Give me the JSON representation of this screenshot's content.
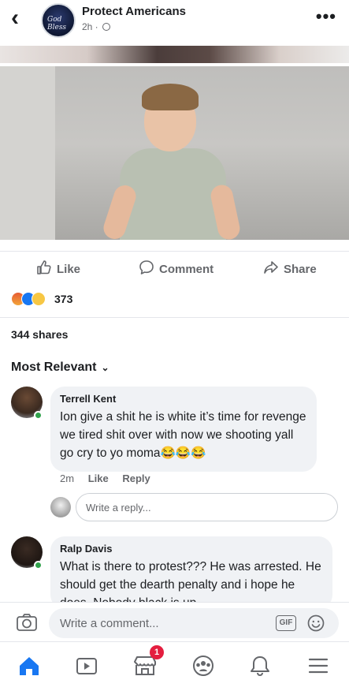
{
  "header": {
    "back_glyph": "‹",
    "page_name": "Protect Americans",
    "page_avatar_text": "God Bless",
    "time": "2h ·",
    "privacy_icon": "globe-icon",
    "more_glyph": "•••"
  },
  "post": {
    "media": "photo-of-smiling-child",
    "actions": {
      "like": "Like",
      "comment": "Comment",
      "share": "Share"
    },
    "reactions": {
      "types": [
        "angry",
        "like",
        "sad"
      ],
      "count": "373"
    },
    "shares": "344 shares"
  },
  "comments_section": {
    "sort_label": "Most Relevant",
    "comments": [
      {
        "author": "Terrell Kent",
        "text": "Ion give a shit he is white it’s time for revenge we tired shit over with now we shooting yall go cry to yo moma😂😂😂",
        "time": "2m",
        "like": "Like",
        "reply": "Reply"
      },
      {
        "author": "Ralp Davis",
        "text": "What is there to protest??? He was arrested. He should get the dearth penalty and i hope he does. Nobody black is up"
      }
    ],
    "reply_placeholder": "Write a reply..."
  },
  "composer": {
    "placeholder": "Write a comment...",
    "gif_label": "GIF"
  },
  "bottom_nav": {
    "items": [
      "home-icon",
      "watch-icon",
      "marketplace-icon",
      "groups-icon",
      "notifications-icon",
      "menu-icon"
    ],
    "marketplace_badge": "1"
  },
  "colors": {
    "accent": "#1877f2",
    "bubble": "#f0f2f5",
    "secondary_text": "#65676b",
    "online": "#31a24c",
    "badge": "#e41e3f"
  }
}
